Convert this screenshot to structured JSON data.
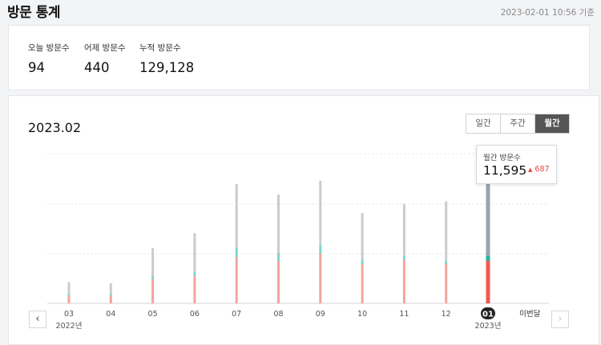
{
  "header": {
    "title": "방문 통계",
    "timestamp": "2023-02-01 10:56 기준"
  },
  "summary": [
    {
      "label": "오늘 방문수",
      "value": "94"
    },
    {
      "label": "어제 방문수",
      "value": "440"
    },
    {
      "label": "누적 방문수",
      "value": "129,128"
    }
  ],
  "chart_header": {
    "period": "2023.02"
  },
  "tabs": [
    {
      "label": "일간",
      "active": false
    },
    {
      "label": "주간",
      "active": false
    },
    {
      "label": "월간",
      "active": true
    }
  ],
  "tooltip": {
    "label": "월간 방문수",
    "value": "11,595",
    "delta": "687",
    "delta_icon": "triangle-up-icon"
  },
  "nav": {
    "prev_icon": "chevron-left-icon",
    "next_icon": "chevron-right-icon"
  },
  "colors": {
    "gray": "#c8ccd0",
    "teal": "#7fd6c9",
    "pink": "#f4a49b",
    "highlight_gray": "#9aa3ac",
    "highlight_teal": "#21b39f",
    "highlight_red": "#ee5a4f",
    "delta": "#e8453c"
  },
  "chart_data": {
    "type": "bar",
    "stacked": true,
    "categories": [
      "03",
      "04",
      "05",
      "06",
      "07",
      "08",
      "09",
      "10",
      "11",
      "12",
      "01",
      "이번달"
    ],
    "year_labels": [
      {
        "category": "03",
        "text": "2022년"
      },
      {
        "category": "01",
        "text": "2023년"
      }
    ],
    "highlighted": "01",
    "series": [
      {
        "values": [
          2100,
          1900,
          4800,
          6800,
          11000,
          10200,
          11100,
          8000,
          9100,
          10300,
          13800,
          0
        ]
      },
      {
        "values": [
          300,
          300,
          600,
          700,
          1700,
          1400,
          1600,
          900,
          700,
          600,
          800,
          0
        ]
      },
      {
        "values": [
          1300,
          1300,
          4200,
          4700,
          8000,
          7300,
          8600,
          6800,
          7500,
          6800,
          7400,
          0
        ]
      }
    ],
    "ylim": [
      0,
      26000
    ],
    "grid": true
  }
}
